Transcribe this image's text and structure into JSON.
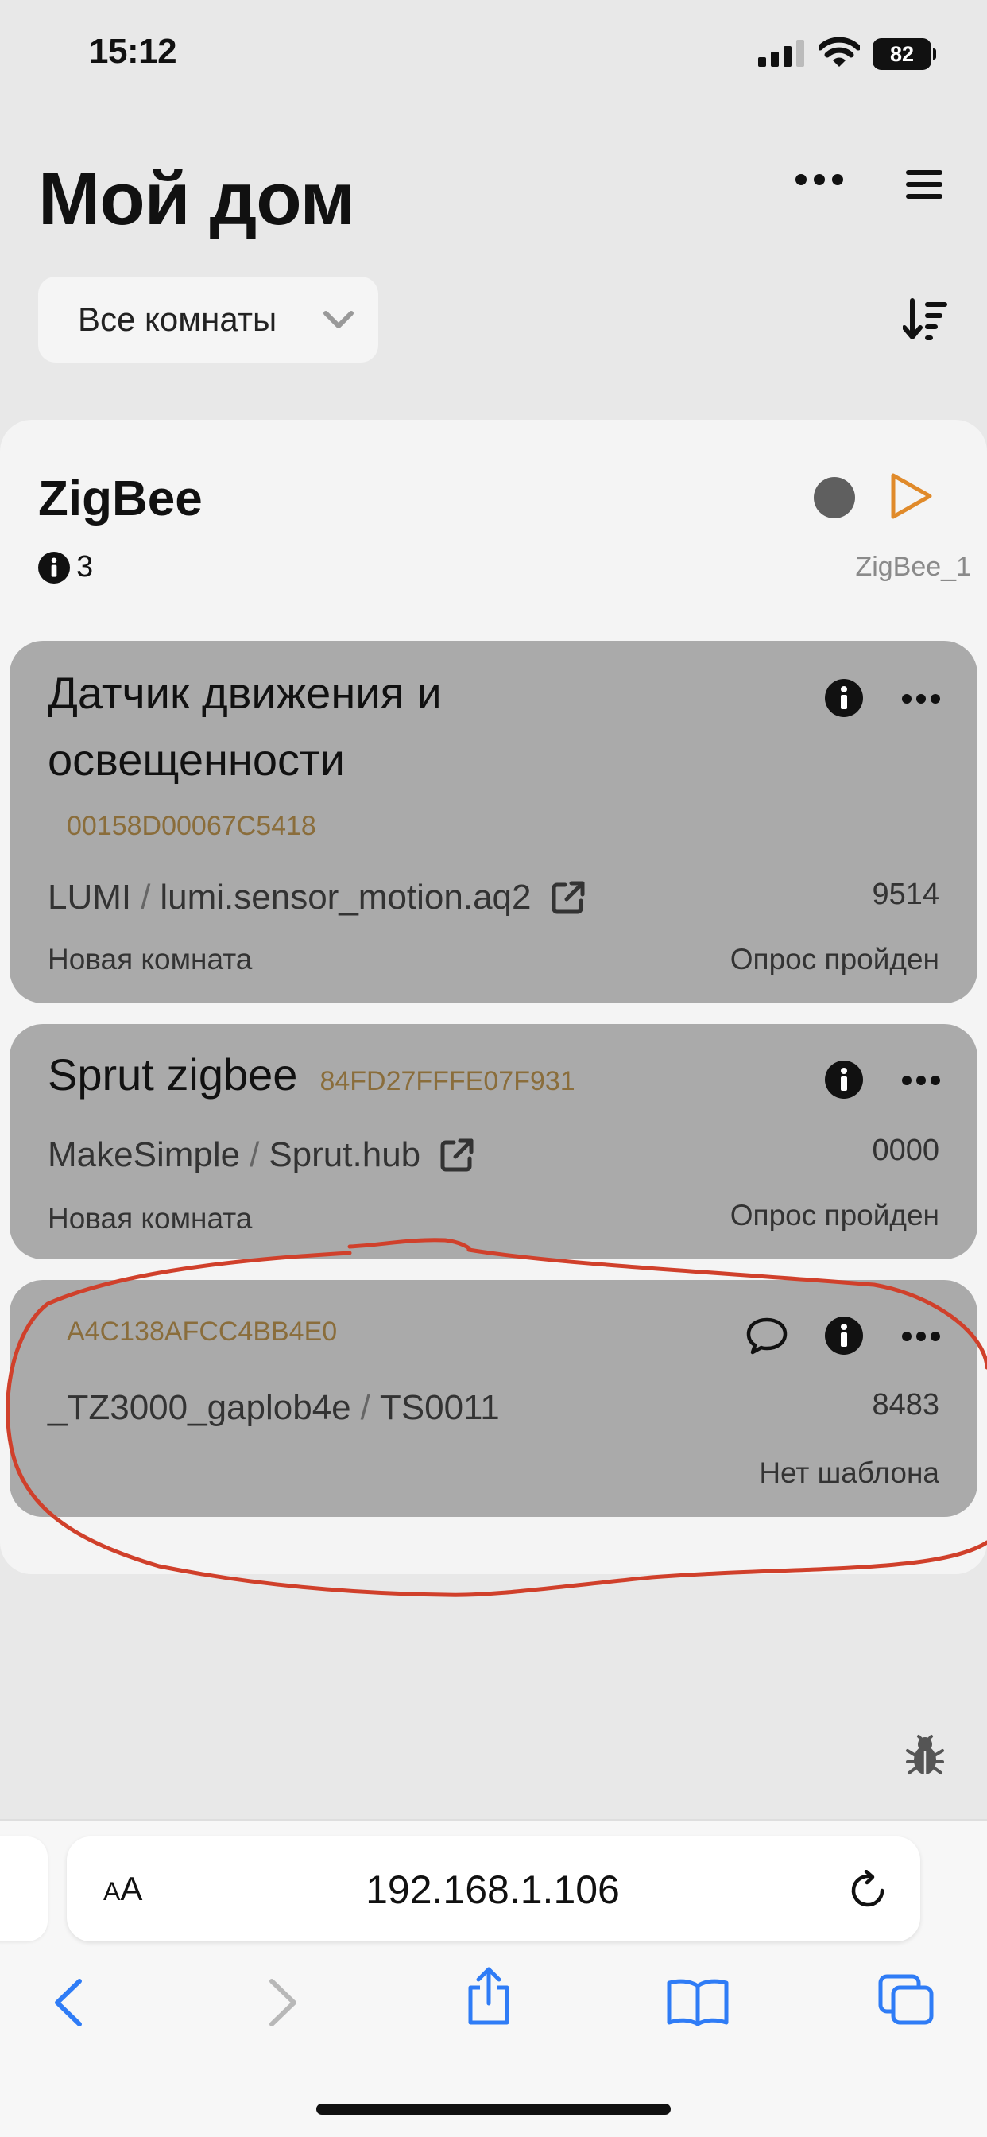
{
  "status_bar": {
    "time": "15:12",
    "battery": "82"
  },
  "header": {
    "title": "Мой дом"
  },
  "filter": {
    "room_select": "Все комнаты"
  },
  "hub": {
    "title": "ZigBee",
    "info_count": "3",
    "name": "ZigBee_1"
  },
  "devices": [
    {
      "title_line1": "Датчик движения и",
      "title_line2": "освещенности",
      "mac": "00158D00067C5418",
      "vendor": "LUMI",
      "model": "lumi.sensor_motion.aq2",
      "number": "9514",
      "room": "Новая комната",
      "status": "Опрос пройден"
    },
    {
      "title": "Sprut zigbee",
      "mac": "84FD27FFFE07F931",
      "vendor": "MakeSimple",
      "model": "Sprut.hub",
      "number": "0000",
      "room": "Новая комната",
      "status": "Опрос пройден"
    },
    {
      "mac": "A4C138AFCC4BB4E0",
      "vendor": "_TZ3000_gaplob4e",
      "model": "TS0011",
      "number": "8483",
      "status": "Нет шаблона"
    }
  ],
  "browser": {
    "aa_big": "A",
    "aa_small": "A",
    "url": "192.168.1.106"
  },
  "colors": {
    "accent_orange": "#e08a2a",
    "mac_text": "#8a6d3b",
    "card_bg": "#aaaaaa",
    "annotation_red": "#d0402b",
    "ios_blue": "#2f7cf6"
  },
  "icons": [
    "info-icon",
    "more-icon",
    "menu-icon",
    "sort-icon",
    "play-icon",
    "external-link-icon",
    "chat-icon",
    "bug-icon",
    "reload-icon",
    "back-icon",
    "forward-icon",
    "share-icon",
    "bookmarks-icon",
    "tabs-icon"
  ]
}
